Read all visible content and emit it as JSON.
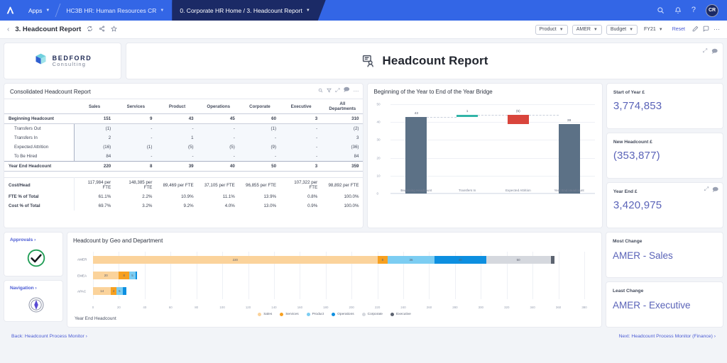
{
  "topbar": {
    "apps_label": "Apps",
    "workspace_label": "HC3B HR: Human Resources CR",
    "breadcrumb_label": "0. Corporate HR Home / 3. Headcount Report",
    "search_icon": "search-icon",
    "bell_icon": "notification-bell-icon",
    "help_icon": "help-question-icon",
    "avatar_initials": "CR"
  },
  "subbar": {
    "back_icon": "chevron-left-icon",
    "title": "3. Headcount Report",
    "refresh_icon": "refresh-icon",
    "share_icon": "share-icon",
    "favorite_icon": "star-icon",
    "filters": [
      {
        "label": "Product",
        "type": "dropdown"
      },
      {
        "label": "AMER",
        "type": "dropdown"
      },
      {
        "label": "Budget",
        "type": "dropdown"
      },
      {
        "label": "FY21",
        "type": "plain"
      }
    ],
    "reset_label": "Reset",
    "edit_icon": "pencil-icon",
    "comment_icon": "comment-icon",
    "more_icon": "more-horizontal-icon"
  },
  "brand": {
    "name": "BEDFORD",
    "tagline": "Consulting",
    "logo_icon": "cube-logo-icon"
  },
  "header": {
    "title": "Headcount Report",
    "icon": "headcount-person-icon",
    "expand_icon": "expand-icon",
    "comment_icon": "comment-icon"
  },
  "table_card": {
    "title": "Consolidated Headcount Report",
    "tools": [
      "search-icon",
      "filter-icon",
      "expand-icon",
      "comment-icon",
      "more-horizontal-icon"
    ],
    "columns": [
      "",
      "Sales",
      "Services",
      "Product",
      "Operations",
      "Corporate",
      "Executive",
      "All Departments"
    ],
    "rows": [
      {
        "label": "Beginning Headcount",
        "style": "total",
        "values": [
          "151",
          "9",
          "43",
          "45",
          "60",
          "3",
          "310"
        ]
      },
      {
        "label": "Transfers Out",
        "style": "sub",
        "values": [
          "(1)",
          "-",
          "-",
          "-",
          "(1)",
          "-",
          "(2)"
        ]
      },
      {
        "label": "Transfers In",
        "style": "sub",
        "values": [
          "2",
          "-",
          "1",
          "-",
          "-",
          "-",
          "3"
        ]
      },
      {
        "label": "Expected Attrition",
        "style": "sub",
        "values": [
          "(16)",
          "(1)",
          "(5)",
          "(5)",
          "(9)",
          "-",
          "(36)"
        ]
      },
      {
        "label": "To Be Hired",
        "style": "sub",
        "values": [
          "84",
          "-",
          "-",
          "-",
          "-",
          "-",
          "84"
        ]
      },
      {
        "label": "Year End Headcount",
        "style": "total",
        "values": [
          "220",
          "8",
          "39",
          "40",
          "50",
          "3",
          "359"
        ]
      }
    ],
    "metrics": [
      {
        "label": "Cost/Head",
        "values": [
          "117,984 per FTE",
          "148,385 per FTE",
          "89,469 per FTE",
          "37,105 per FTE",
          "96,855 per FTE",
          "107,322 per FTE",
          "98,892 per FTE"
        ]
      },
      {
        "label": "FTE % of Total",
        "values": [
          "61.1%",
          "2.2%",
          "10.9%",
          "11.1%",
          "13.9%",
          "0.8%",
          "100.0%"
        ]
      },
      {
        "label": "Cost % of Total",
        "values": [
          "69.7%",
          "3.2%",
          "9.2%",
          "4.0%",
          "13.0%",
          "0.9%",
          "100.0%"
        ]
      }
    ]
  },
  "bridge_card": {
    "title": "Beginning of the Year to End of the Year Bridge"
  },
  "kpis": [
    {
      "label": "Start of Year £",
      "value": "3,774,853"
    },
    {
      "label": "New Headcount £",
      "value": "(353,877)"
    },
    {
      "label": "Year End £",
      "value": "3,420,975",
      "expand_icon": "expand-icon",
      "comment_icon": "comment-icon"
    }
  ],
  "side_cards": [
    {
      "label": "Approvals ›",
      "icon": "approval-check-icon"
    },
    {
      "label": "Navigation ›",
      "icon": "navigation-compass-icon"
    }
  ],
  "geo_card": {
    "title": "Headcount by Geo and Department",
    "footer": "Year End Headcount"
  },
  "kpis2": [
    {
      "label": "Most Change",
      "value": "AMER - Sales"
    },
    {
      "label": "Least Change",
      "value": "AMER - Executive"
    }
  ],
  "footer": {
    "back_label": "Back: Headcount Process Monitor ›",
    "next_label": "Next: Headcount Process Monitor (Finance) ›"
  },
  "colors": {
    "brand_blue": "#3366e6",
    "accent_purple": "#5a63b8",
    "bar_slate": "#5c7186",
    "bar_teal": "#32b4a8",
    "bar_red": "#d9453c",
    "sales": "#fbd39b",
    "services": "#f7a020",
    "product": "#7ccdf2",
    "operations": "#0d8fe0",
    "corporate": "#d5d8de",
    "executive": "#5c6370"
  },
  "chart_data": [
    {
      "type": "bar",
      "name": "bridge-waterfall",
      "title": "Beginning of the Year to End of the Year Bridge",
      "categories": [
        "Beginning Headcount",
        "Transfers In",
        "Expected Attrition",
        "Year End Headcount"
      ],
      "values": [
        43,
        1,
        -5,
        39
      ],
      "labels": [
        "43",
        "1",
        "(5)",
        "39"
      ],
      "bar_bases": [
        0,
        43,
        39,
        0
      ],
      "bar_tops": [
        43,
        44,
        44,
        39
      ],
      "bar_colors": [
        "#5c7186",
        "#32b4a8",
        "#d9453c",
        "#5c7186"
      ],
      "ylim": [
        0,
        50
      ],
      "yticks": [
        0,
        10,
        20,
        30,
        40,
        50
      ],
      "xlabel": "",
      "ylabel": "",
      "grid": true,
      "legend": "none"
    },
    {
      "type": "bar",
      "name": "headcount-by-geo-and-department",
      "title": "Headcount by Geo and Department",
      "orientation": "horizontal",
      "stacked": true,
      "categories": [
        "AMER",
        "EMEA",
        "APAC"
      ],
      "series": [
        {
          "name": "Sales",
          "color": "#fbd39b",
          "values": [
            220,
            20,
            14
          ]
        },
        {
          "name": "Services",
          "color": "#f7a020",
          "values": [
            8,
            8,
            4
          ]
        },
        {
          "name": "Product",
          "color": "#7ccdf2",
          "values": [
            36,
            5,
            5
          ]
        },
        {
          "name": "Operations",
          "color": "#0d8fe0",
          "values": [
            40,
            1,
            3
          ]
        },
        {
          "name": "Corporate",
          "color": "#d5d8de",
          "values": [
            50,
            0,
            0
          ]
        },
        {
          "name": "Executive",
          "color": "#5c6370",
          "values": [
            3,
            0,
            0
          ]
        }
      ],
      "xlim": [
        0,
        380
      ],
      "xticks": [
        0,
        20,
        40,
        60,
        80,
        100,
        120,
        140,
        160,
        180,
        200,
        220,
        240,
        260,
        280,
        300,
        320,
        340,
        360,
        380
      ],
      "legend": "bottom",
      "grid": true,
      "footer": "Year End Headcount"
    }
  ]
}
